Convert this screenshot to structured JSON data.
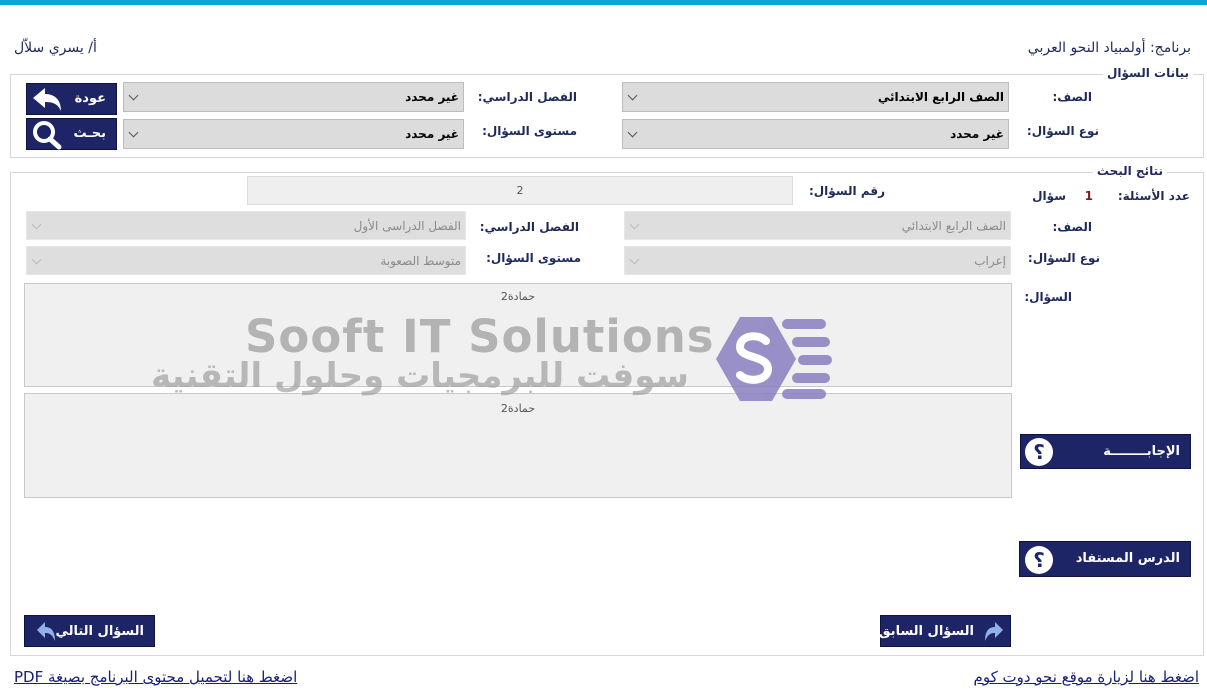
{
  "header": {
    "program_title": "برنامج: أولمبياد النحو العربي",
    "author": "أ/ يسري سلاّل"
  },
  "question_data_panel": {
    "legend": "بيانات السؤال",
    "grade_label": "الصف:",
    "grade_value": "الصف الرابع الابتدائي",
    "term_label": "الفصل الدراسي:",
    "term_value": "غير محدد",
    "qtype_label": "نوع السؤال:",
    "qtype_value": "غير محدد",
    "level_label": "مستوى السؤال:",
    "level_value": "غير محدد",
    "back_button": "عودة",
    "search_button": "بحـث"
  },
  "results_panel": {
    "legend": "نتائج البحث",
    "count_label": "عدد الأسئلة:",
    "count_value": "1",
    "count_unit": "سؤال",
    "qnum_label": "رقم السؤال:",
    "qnum_value": "2",
    "grade_label": "الصف:",
    "grade_value": "الصف الرابع الابتدائي",
    "term_label": "الفصل الدراسي:",
    "term_value": "الفصل الدراسى الأول",
    "qtype_label": "نوع السؤال:",
    "qtype_value": "إعراب",
    "level_label": "مستوى السؤال:",
    "level_value": "متوسط الصعوبة",
    "question_label": "السؤال:",
    "question_text": "حمادة2",
    "answer_text": "حمادة2",
    "answer_button": "الإجابــــــــة",
    "lesson_button": "الدرس المستفاد",
    "prev_button": "السؤال السابق",
    "next_button": "السؤال التالي"
  },
  "watermark": {
    "english": "Sooft IT Solutions",
    "arabic": "سوفت للبرمجيات وحلول التقنية"
  },
  "footer": {
    "visit_link": "اضغط هنا لزيارة موقع  نحو دوت كوم",
    "pdf_link": "اضغط هنا لتحميل محتوى البرنامج بصيغة PDF"
  },
  "colors": {
    "accent_bar": "#0aa6d6",
    "navy": "#1e2566",
    "watermark_logo": "#8a7fc0"
  }
}
